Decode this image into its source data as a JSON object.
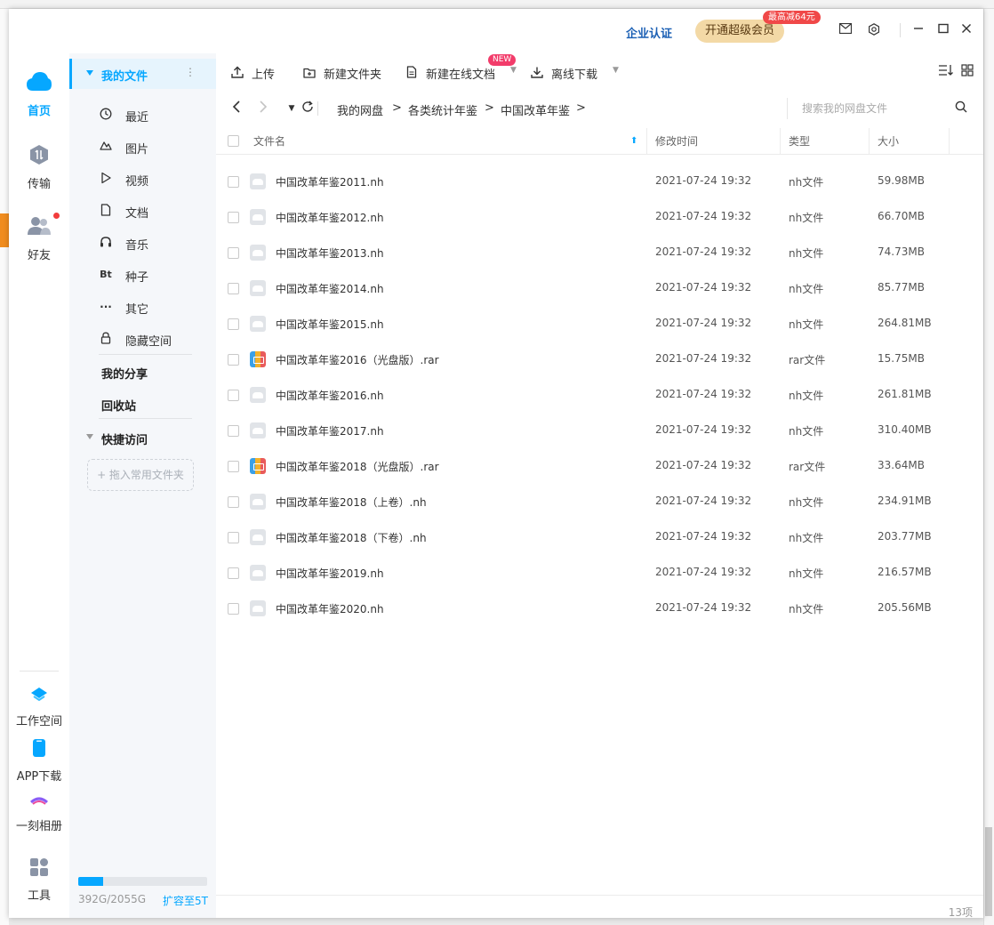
{
  "header": {
    "enterprise_label": "企业认证",
    "vip_button": "开通超级会员",
    "vip_badge": "最高减64元"
  },
  "rail": {
    "items": [
      {
        "label": "首页",
        "icon": "cloud-icon",
        "active": true
      },
      {
        "label": "传输",
        "icon": "transfer-icon"
      },
      {
        "label": "好友",
        "icon": "friends-icon"
      },
      {
        "label": "工作空间",
        "icon": "workspace-icon"
      },
      {
        "label": "APP下载",
        "icon": "phone-icon"
      },
      {
        "label": "一刻相册",
        "icon": "album-icon"
      },
      {
        "label": "工具",
        "icon": "tools-icon"
      }
    ]
  },
  "sidebar": {
    "my_files": "我的文件",
    "items": [
      {
        "label": "最近",
        "icon": "clock-icon"
      },
      {
        "label": "图片",
        "icon": "image-icon"
      },
      {
        "label": "视频",
        "icon": "video-icon"
      },
      {
        "label": "文档",
        "icon": "document-icon"
      },
      {
        "label": "音乐",
        "icon": "headphones-icon"
      },
      {
        "label": "种子",
        "icon": "bt-icon"
      },
      {
        "label": "其它",
        "icon": "more-icon"
      },
      {
        "label": "隐藏空间",
        "icon": "lock-icon"
      }
    ],
    "my_share": "我的分享",
    "recycle_bin": "回收站",
    "quick_access": "快捷访问",
    "drop_hint": "+ 拖入常用文件夹",
    "quota_text": "392G/2055G",
    "quota_used_fraction": 0.19,
    "expand_label": "扩容至5T"
  },
  "toolbar": {
    "upload": "上传",
    "new_folder": "新建文件夹",
    "new_online_doc": "新建在线文档",
    "new_badge": "NEW",
    "offline_download": "离线下载"
  },
  "breadcrumb": {
    "items": [
      "我的网盘",
      "各类统计年鉴",
      "中国改革年鉴"
    ]
  },
  "search": {
    "placeholder": "搜索我的网盘文件"
  },
  "table": {
    "headers": {
      "name": "文件名",
      "modified": "修改时间",
      "type": "类型",
      "size": "大小"
    },
    "rows": [
      {
        "name": "中国改革年鉴2011.nh",
        "modified": "2021-07-24 19:32",
        "type": "nh文件",
        "size": "59.98MB",
        "kind": "nh"
      },
      {
        "name": "中国改革年鉴2012.nh",
        "modified": "2021-07-24 19:32",
        "type": "nh文件",
        "size": "66.70MB",
        "kind": "nh"
      },
      {
        "name": "中国改革年鉴2013.nh",
        "modified": "2021-07-24 19:32",
        "type": "nh文件",
        "size": "74.73MB",
        "kind": "nh"
      },
      {
        "name": "中国改革年鉴2014.nh",
        "modified": "2021-07-24 19:32",
        "type": "nh文件",
        "size": "85.77MB",
        "kind": "nh"
      },
      {
        "name": "中国改革年鉴2015.nh",
        "modified": "2021-07-24 19:32",
        "type": "nh文件",
        "size": "264.81MB",
        "kind": "nh"
      },
      {
        "name": "中国改革年鉴2016（光盘版）.rar",
        "modified": "2021-07-24 19:32",
        "type": "rar文件",
        "size": "15.75MB",
        "kind": "rar"
      },
      {
        "name": "中国改革年鉴2016.nh",
        "modified": "2021-07-24 19:32",
        "type": "nh文件",
        "size": "261.81MB",
        "kind": "nh"
      },
      {
        "name": "中国改革年鉴2017.nh",
        "modified": "2021-07-24 19:32",
        "type": "nh文件",
        "size": "310.40MB",
        "kind": "nh"
      },
      {
        "name": "中国改革年鉴2018（光盘版）.rar",
        "modified": "2021-07-24 19:32",
        "type": "rar文件",
        "size": "33.64MB",
        "kind": "rar"
      },
      {
        "name": "中国改革年鉴2018（上卷）.nh",
        "modified": "2021-07-24 19:32",
        "type": "nh文件",
        "size": "234.91MB",
        "kind": "nh"
      },
      {
        "name": "中国改革年鉴2018（下卷）.nh",
        "modified": "2021-07-24 19:32",
        "type": "nh文件",
        "size": "203.77MB",
        "kind": "nh"
      },
      {
        "name": "中国改革年鉴2019.nh",
        "modified": "2021-07-24 19:32",
        "type": "nh文件",
        "size": "216.57MB",
        "kind": "nh"
      },
      {
        "name": "中国改革年鉴2020.nh",
        "modified": "2021-07-24 19:32",
        "type": "nh文件",
        "size": "205.56MB",
        "kind": "nh"
      }
    ]
  },
  "footer": {
    "count": "13项"
  },
  "colors": {
    "accent": "#06a7ff",
    "vip_bg": "#f3d9a6",
    "badge_red": "#f04848"
  }
}
